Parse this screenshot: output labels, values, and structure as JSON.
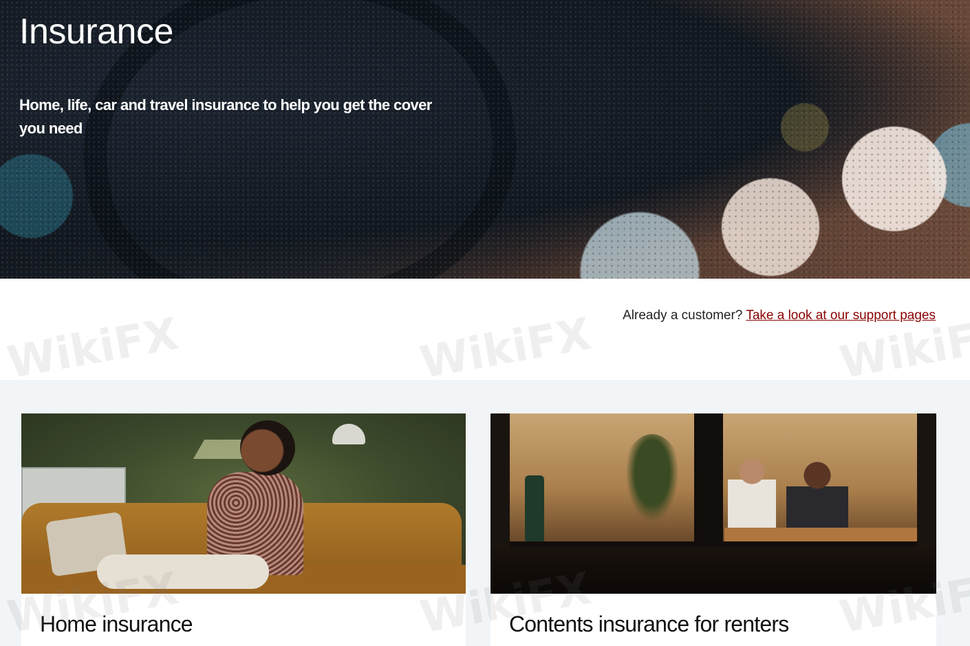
{
  "hero": {
    "title": "Insurance",
    "subtitle": "Home, life, car and travel insurance to help you get the cover you need"
  },
  "customer_prompt": {
    "text": "Already a customer?",
    "link_text": "Take a look at our support pages",
    "link_color": "#8a0000"
  },
  "cards": [
    {
      "title": "Home insurance",
      "image": "woman-on-sofa-photo"
    },
    {
      "title": "Contents insurance for renters",
      "image": "couple-at-window-photo"
    }
  ],
  "watermark": {
    "text": "WikiFX"
  },
  "colors": {
    "section_background": "#f1f5f8",
    "text": "#222222"
  }
}
